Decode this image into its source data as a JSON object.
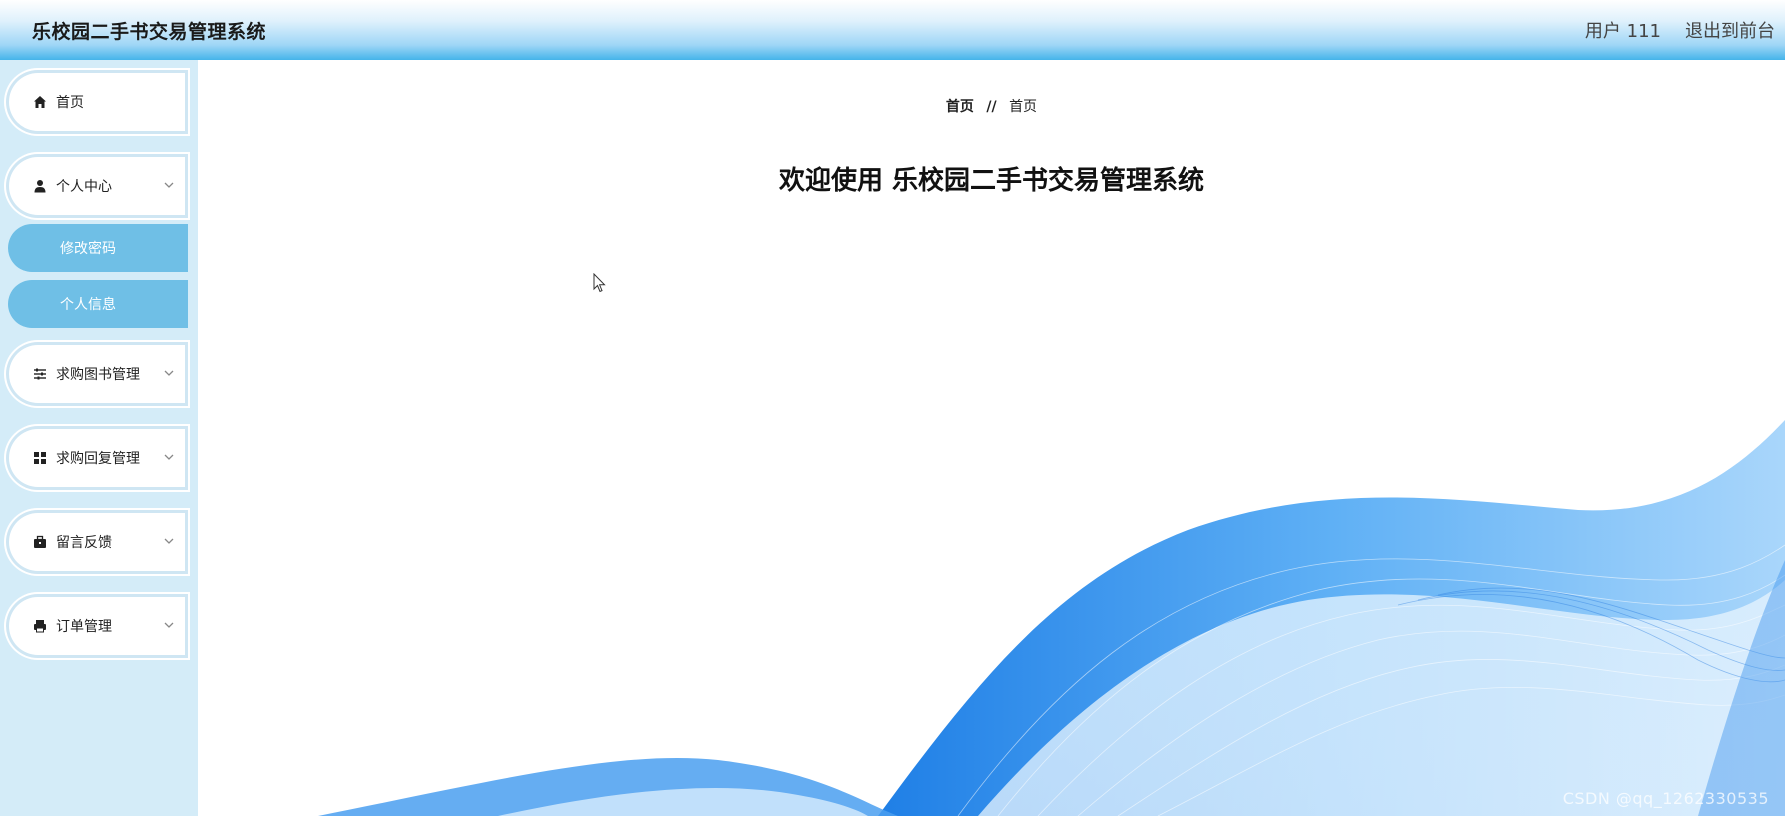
{
  "header": {
    "title": "乐校园二手书交易管理系统",
    "user_label": "用户 111",
    "exit_label": "退出到前台"
  },
  "sidebar": {
    "items": [
      {
        "label": "首页",
        "icon": "home-icon"
      },
      {
        "label": "个人中心",
        "icon": "user-icon",
        "sub": [
          "修改密码",
          "个人信息"
        ]
      },
      {
        "label": "求购图书管理",
        "icon": "sliders-icon"
      },
      {
        "label": "求购回复管理",
        "icon": "grid-icon"
      },
      {
        "label": "留言反馈",
        "icon": "briefcase-icon"
      },
      {
        "label": "订单管理",
        "icon": "printer-icon"
      }
    ]
  },
  "main": {
    "breadcrumb": {
      "home": "首页",
      "separator": "//",
      "current": "首页"
    },
    "welcome": "欢迎使用 乐校园二手书交易管理系统"
  },
  "watermark": "CSDN @qq_1262330535",
  "colors": {
    "sidebar_bg": "#d4ecf8",
    "submenu_bg": "#6fbfe6",
    "header_gradient_end": "#45b4ea",
    "wave_blue": "#2f8ff0"
  }
}
